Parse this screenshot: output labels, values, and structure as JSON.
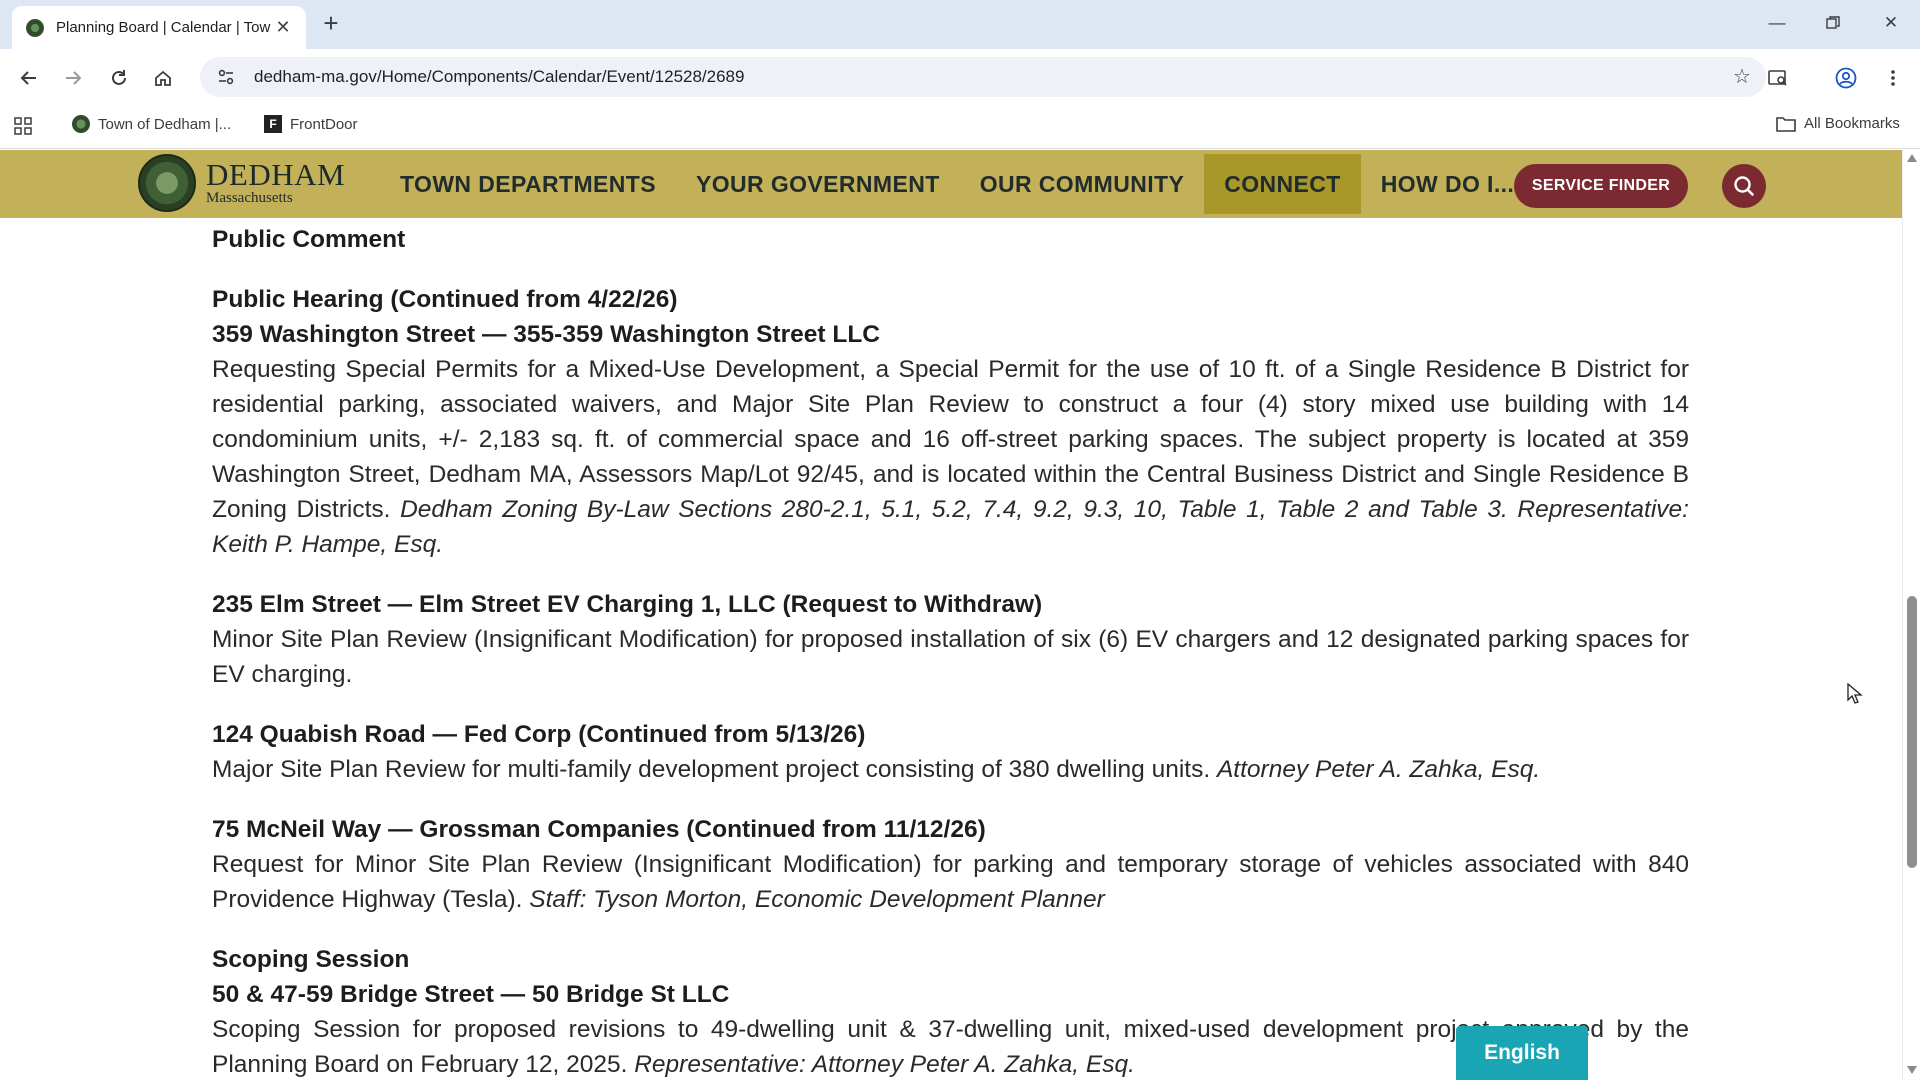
{
  "browser": {
    "tab_title": "Planning Board | Calendar | Tow",
    "url": "dedham-ma.gov/Home/Components/Calendar/Event/12528/2689",
    "bookmarks": [
      {
        "label": "Town of Dedham |...",
        "icon": "globe-icon"
      },
      {
        "label": "FrontDoor",
        "icon": "frontdoor-icon"
      }
    ],
    "all_bookmarks": "All Bookmarks"
  },
  "site": {
    "logo_name": "DEDHAM",
    "logo_sub": "Massachusetts",
    "nav": [
      "TOWN DEPARTMENTS",
      "YOUR GOVERNMENT",
      "OUR COMMUNITY",
      "CONNECT",
      "HOW DO I..."
    ],
    "active_nav": "CONNECT",
    "service_finder": "SERVICE FINDER",
    "colors": {
      "header_bg": "#c2b159",
      "active_nav": "#a89829",
      "accent": "#7b2a31",
      "language_btn": "#1aa5b5"
    }
  },
  "content": {
    "public_comment": "Public Comment",
    "hearing": {
      "heading": "Public Hearing (Continued from 4/22/26)",
      "title": "359 Washington Street — 355-359 Washington Street LLC",
      "body": "Requesting Special Permits for a Mixed-Use Development, a Special Permit for the use of 10 ft. of a Single Residence B District for residential parking, associated waivers, and Major Site Plan Review to construct a four (4) story mixed use building with 14 condominium units, +/- 2,183 sq. ft. of commercial space and 16 off-street parking spaces.  The subject property is located at 359 Washington Street, Dedham MA, Assessors Map/Lot 92/45, and is located within the Central Business District and Single Residence B Zoning Districts.  ",
      "body_italic": "Dedham Zoning By-Law Sections 280-2.1, 5.1, 5.2, 7.4, 9.2, 9.3, 10, Table 1, Table 2 and Table 3. Representative: Keith P. Hampe, Esq."
    },
    "elm": {
      "title": "235 Elm Street — Elm Street EV Charging 1, LLC (Request to Withdraw)",
      "body": "Minor Site Plan Review (Insignificant Modification) for proposed installation of six (6) EV chargers and 12 designated parking spaces for EV charging."
    },
    "quabish": {
      "title": "124 Quabish Road — Fed Corp (Continued from 5/13/26)",
      "body": "Major Site Plan Review for multi-family development project consisting of 380 dwelling units. ",
      "body_italic": "Attorney Peter A. Zahka, Esq."
    },
    "mcneil": {
      "title": "75 McNeil Way — Grossman Companies (Continued from 11/12/26)",
      "body": "Request for Minor Site Plan Review (Insignificant Modification) for parking and temporary storage of vehicles associated with 840 Providence Highway (Tesla). ",
      "body_italic": "Staff: Tyson Morton, Economic Development Planner"
    },
    "scoping": {
      "heading": "Scoping Session",
      "title": "50 & 47-59 Bridge Street — 50 Bridge St LLC",
      "body": "Scoping Session for proposed revisions to 49-dwelling unit & 37-dwelling unit, mixed-used development project approved by the Planning Board on February 12, 2025. ",
      "body_italic": "Representative: Attorney Peter A. Zahka, Esq."
    }
  },
  "language_button": "English"
}
